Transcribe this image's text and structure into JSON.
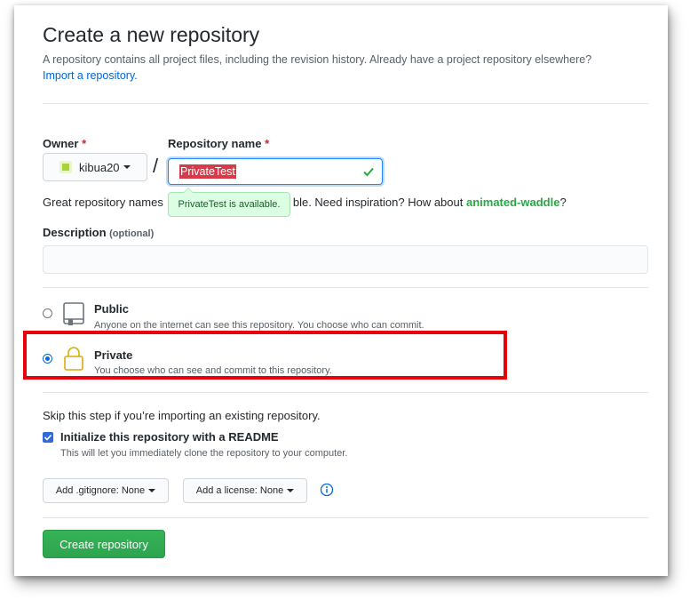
{
  "header": {
    "title": "Create a new repository",
    "subtitle": "A repository contains all project files, including the revision history. Already have a project repository elsewhere?",
    "import_link": "Import a repository."
  },
  "owner": {
    "label": "Owner",
    "required": "*",
    "value": "kibua20"
  },
  "repo_name": {
    "label": "Repository name",
    "required": "*",
    "value": "PrivateTest",
    "separator": "/"
  },
  "hint": {
    "text_start": "Great repository names",
    "text_end": "ble. Need inspiration? How about",
    "suggestion": "animated-waddle",
    "end": "?",
    "tooltip": "PrivateTest is available."
  },
  "description": {
    "label": "Description",
    "optional": "(optional)",
    "value": ""
  },
  "visibility": {
    "public_title": "Public",
    "public_desc": "Anyone on the internet can see this repository. You choose who can commit.",
    "private_title": "Private",
    "private_desc": "You choose who can see and commit to this repository.",
    "selected": "private"
  },
  "init": {
    "skip_text": "Skip this step if you’re importing an existing repository.",
    "readme_title": "Initialize this repository with a README",
    "readme_desc": "This will let you immediately clone the repository to your computer.",
    "readme_checked": true,
    "gitignore_label": "Add .gitignore: None",
    "license_label": "Add a license: None"
  },
  "actions": {
    "create_label": "Create repository"
  },
  "colors": {
    "accent": "#0366d6",
    "success": "#28a745",
    "highlight": "#e8000b"
  }
}
